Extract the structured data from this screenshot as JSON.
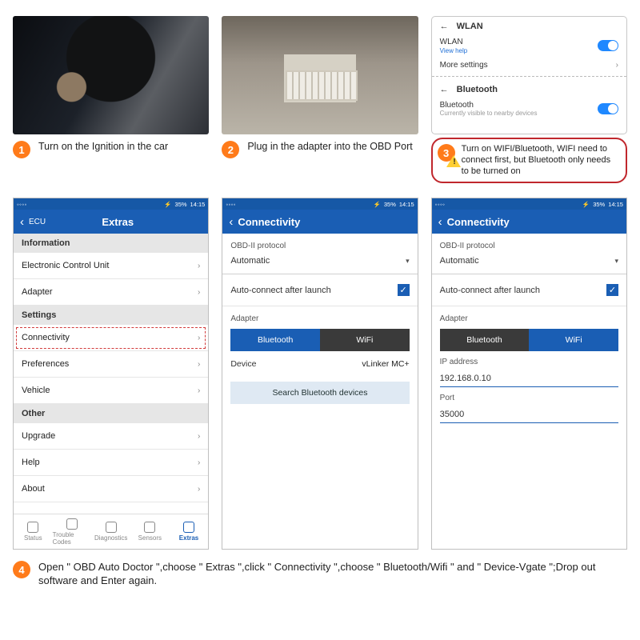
{
  "wlan_panel": {
    "header": "WLAN",
    "wlan_label": "WLAN",
    "view_help": "View help",
    "more_settings": "More settings",
    "bt_header": "Bluetooth",
    "bt_label": "Bluetooth",
    "bt_sub": "Currently visible to nearby devices"
  },
  "steps": {
    "s1_num": "1",
    "s1_text": "Turn on the Ignition in the car",
    "s2_num": "2",
    "s2_text": "Plug in the adapter into the OBD Port",
    "s3_num": "3",
    "s3_text": "Turn on WIFI/Bluetooth, WIFI need to connect first, but Bluetooth only needs to be turned on",
    "s4_num": "4",
    "s4_text": "Open \" OBD Auto Doctor \",choose \" Extras \",click \" Connectivity \",choose \" Bluetooth/Wifi \" and \" Device-Vgate \";Drop out software and Enter again."
  },
  "status": {
    "battery": "35%",
    "time": "14:15"
  },
  "screen1": {
    "back": "ECU",
    "title": "Extras",
    "sec_info": "Information",
    "it_ecu": "Electronic Control Unit",
    "it_adapter": "Adapter",
    "sec_settings": "Settings",
    "it_conn": "Connectivity",
    "it_pref": "Preferences",
    "it_vehicle": "Vehicle",
    "sec_other": "Other",
    "it_upgrade": "Upgrade",
    "it_help": "Help",
    "it_about": "About",
    "tabs": {
      "t1": "Status",
      "t2": "Trouble Codes",
      "t3": "Diagnostics",
      "t4": "Sensors",
      "t5": "Extras"
    }
  },
  "screen2": {
    "title": "Connectivity",
    "obd_label": "OBD-II protocol",
    "obd_value": "Automatic",
    "auto_connect": "Auto-connect after launch",
    "adapter_label": "Adapter",
    "seg_bt": "Bluetooth",
    "seg_wifi": "WiFi",
    "device_label": "Device",
    "device_value": "vLinker MC+",
    "search_btn": "Search Bluetooth devices"
  },
  "screen3": {
    "title": "Connectivity",
    "obd_label": "OBD-II protocol",
    "obd_value": "Automatic",
    "auto_connect": "Auto-connect after launch",
    "adapter_label": "Adapter",
    "seg_bt": "Bluetooth",
    "seg_wifi": "WiFi",
    "ip_label": "IP address",
    "ip_value": "192.168.0.10",
    "port_label": "Port",
    "port_value": "35000"
  }
}
